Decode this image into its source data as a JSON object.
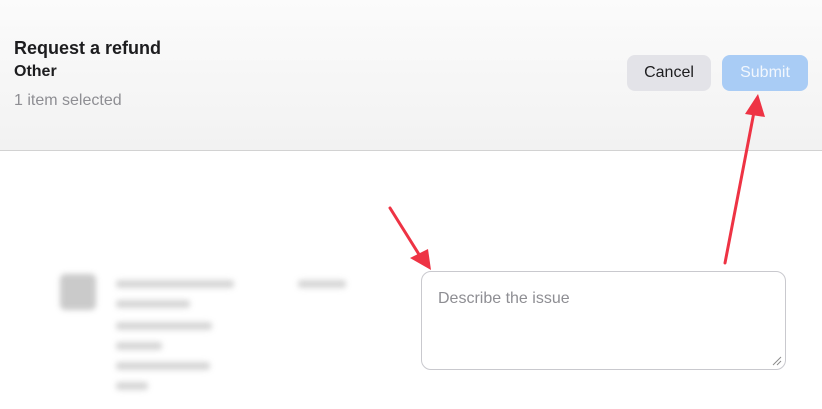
{
  "header": {
    "title": "Request a refund",
    "subtitle": "Other",
    "selection_status": "1 item selected"
  },
  "actions": {
    "cancel_label": "Cancel",
    "submit_label": "Submit",
    "submit_enabled": false
  },
  "issue_input": {
    "placeholder": "Describe the issue",
    "value": ""
  },
  "colors": {
    "submit_disabled_bg": "#a9ccf5",
    "cancel_bg": "#e3e3e8",
    "annotation_arrow": "#ee3344"
  },
  "annotations": {
    "arrow_icon": "arrow-icon"
  }
}
